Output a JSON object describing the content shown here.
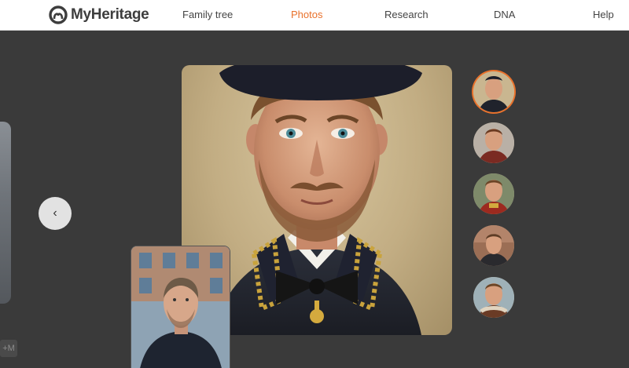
{
  "header": {
    "logo_text": "MyHeritage",
    "nav": [
      {
        "label": "Family tree",
        "active": false
      },
      {
        "label": "Photos",
        "active": true
      },
      {
        "label": "Research",
        "active": false
      },
      {
        "label": "DNA",
        "active": false
      },
      {
        "label": "Help",
        "active": false
      }
    ],
    "accent_color": "#e9712b"
  },
  "viewer": {
    "prev_badge": "+M",
    "prev_button_icon": "chevron-left-icon",
    "prev_button_glyph": "‹",
    "thumbnails": [
      {
        "name": "military-portrait",
        "selected": true
      },
      {
        "name": "red-jacket-portrait",
        "selected": false
      },
      {
        "name": "red-uniform-portrait",
        "selected": false
      },
      {
        "name": "street-portrait",
        "selected": false
      },
      {
        "name": "fur-collar-portrait",
        "selected": false
      }
    ]
  }
}
